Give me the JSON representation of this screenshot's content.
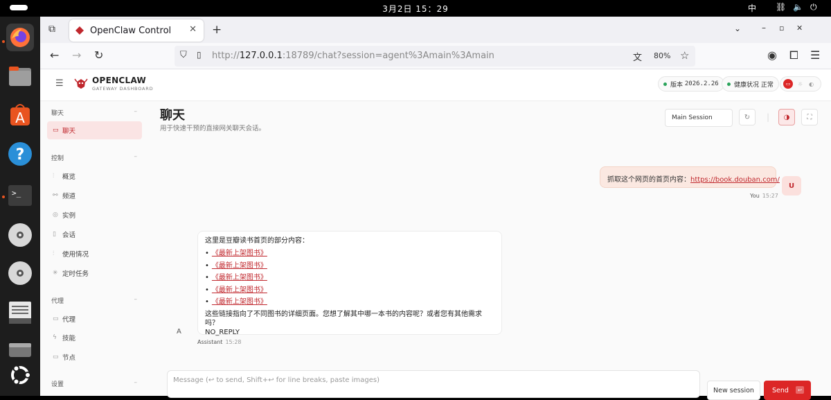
{
  "system": {
    "clock": "3月2日  15：29",
    "ime": "中"
  },
  "browser": {
    "tab_title": "OpenClaw Control",
    "url_prefix": "http://",
    "url_host": "127.0.0.1",
    "url_rest": ":18789/chat?session=agent%3Amain%3Amain",
    "zoom": "80%"
  },
  "header": {
    "brand_name": "OPENCLAW",
    "brand_sub": "GATEWAY DASHBOARD",
    "version_label": "版本",
    "version_value": "2026.2.26",
    "health_label": "健康状况",
    "health_value": "正常"
  },
  "sidebar": {
    "sections": [
      {
        "title": "聊天",
        "items": [
          "聊天"
        ]
      },
      {
        "title": "控制",
        "items": [
          "概览",
          "频道",
          "实例",
          "会话",
          "使用情况",
          "定时任务"
        ]
      },
      {
        "title": "代理",
        "items": [
          "代理",
          "技能",
          "节点"
        ]
      },
      {
        "title": "设置",
        "items": []
      }
    ]
  },
  "page": {
    "title": "聊天",
    "subtitle": "用于快速干预的直接网关聊天会话。",
    "session_select": "Main Session"
  },
  "messages": {
    "user": {
      "text": "抓取这个网页的首页内容：",
      "link": "https://book.douban.com/",
      "avatar": "U",
      "sender": "You",
      "time": "15:27"
    },
    "assistant": {
      "intro": "这里是豆瓣读书首页的部分内容：",
      "links": [
        "《最新上架图书》",
        "《最新上架图书》",
        "《最新上架图书》",
        "《最新上架图书》",
        "《最新上架图书》"
      ],
      "outro": "这些链接指向了不同图书的详细页面。您想了解其中哪一本书的内容呢？或者您有其他需求吗？",
      "tail": "NO_REPLY",
      "avatar": "A",
      "sender": "Assistant",
      "time": "15:28"
    }
  },
  "composer": {
    "placeholder": "Message (↩ to send, Shift+↩ for line breaks, paste images)",
    "new_session": "New session",
    "send": "Send",
    "send_key": "↩"
  },
  "colors": {
    "accent": "#dc2626",
    "user_bubble": "#fbe8e1",
    "status_ok": "#2aa35a"
  }
}
